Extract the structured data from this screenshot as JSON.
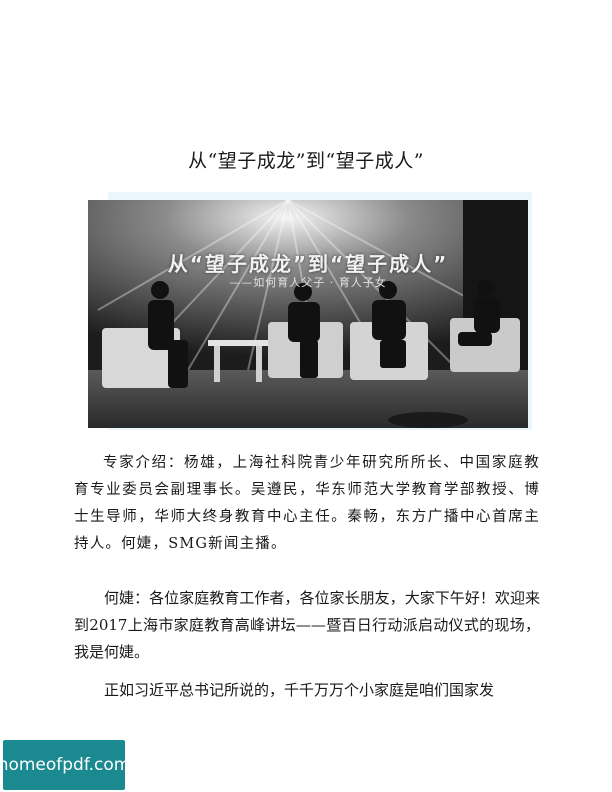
{
  "document": {
    "title": "从“望子成龙”到“望子成人”",
    "photo": {
      "banner_title": "从“望子成龙”到“望子成人”",
      "banner_subtitle": "——如何育人父子 · 育人子女"
    },
    "paragraphs": [
      "专家介绍：杨雄，上海社科院青少年研究所所长、中国家庭教育专业委员会副理事长。吴遵民，华东师范大学教育学部教授、博士生导师，华师大终身教育中心主任。秦畅，东方广播中心首席主持人。何婕，SMG新闻主播。",
      "何婕：各位家庭教育工作者，各位家长朋友，大家下午好！欢迎来到2017上海市家庭教育高峰讲坛——暨百日行动派启动仪式的现场，我是何婕。",
      "正如习近平总书记所说的，千千万万个小家庭是咱们国家发"
    ]
  },
  "watermark": {
    "text": "homeofpdf.com"
  }
}
